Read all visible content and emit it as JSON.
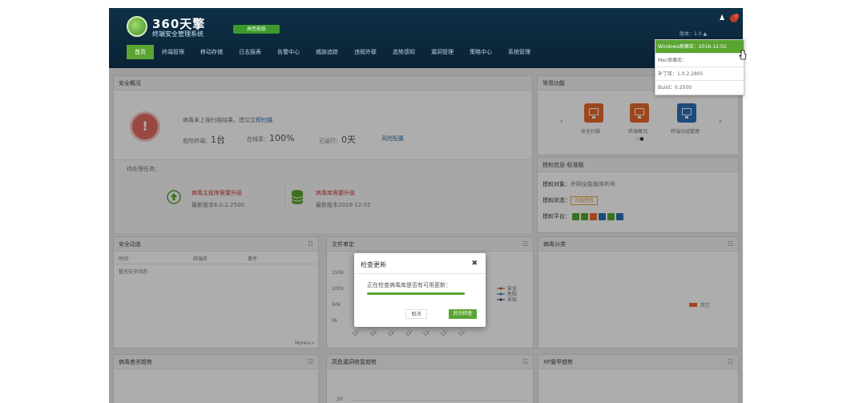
{
  "header": {
    "app_name": "360天擎",
    "app_subtitle": "终端安全管理系统",
    "edition": "高性能版",
    "version": "版本：1.0",
    "nav": [
      "首页",
      "终端管理",
      "移动存储",
      "日志报表",
      "告警中心",
      "威胁追踪",
      "违规外联",
      "态势感知",
      "漏洞管理",
      "策略中心",
      "系统管理"
    ]
  },
  "version_dropdown": {
    "items": [
      "Windows病毒库：2016-12-02",
      "Mac病毒库：",
      "补丁库：1.0.2.2805",
      "Build：0.2500"
    ]
  },
  "security_overview": {
    "title": "安全概况",
    "icon_text": "!",
    "message_prefix": "病毒未上报扫描结果，建议",
    "message_link": "立即扫描",
    "message_suffix": "",
    "risk_label": "危险终端：",
    "risk_value": "1台",
    "secure_label": "在线率：",
    "secure_value": "100%",
    "days_label": "已运行：",
    "days_value": "0天",
    "detail_link": "风险配置",
    "pending_title": "待处理任务：",
    "task1_title": "病毒主程序需要升级",
    "task1_sub": "最新版本6.0.2.2500",
    "task2_title": "病毒库需要升级",
    "task2_sub": "最新版本2016-12-02"
  },
  "common_functions": {
    "title": "常用功能",
    "items": [
      "安全扫描",
      "终端概况",
      "终端分组管理"
    ]
  },
  "license": {
    "title": "授权信息-标准版",
    "object_label": "授权对象：",
    "object_value": "外网全能版序列号",
    "status_label": "授权状态：",
    "status_value": "正版授权",
    "platform_label": "授权平台："
  },
  "security_dynamics": {
    "title": "安全动态",
    "columns": [
      "时间",
      "终端名",
      "事件"
    ],
    "empty": "暂无安全动态",
    "more": "More>>"
  },
  "file_audit": {
    "title": "文件审定",
    "legend": [
      "安全",
      "危险",
      "未知"
    ]
  },
  "virus_category": {
    "title": "病毒分类",
    "legend": "其它"
  },
  "bottom_panels": [
    "病毒查杀趋势",
    "高危漏洞修复趋势",
    "XP盾甲趋势"
  ],
  "chart_data": {
    "type": "line",
    "title": "文件审定",
    "y_ticks": [
      "150k",
      "100k",
      "50k",
      "0k"
    ],
    "x_ticks": [
      "12-",
      "12-",
      "12-",
      "12-",
      "12-",
      "12-",
      "12-"
    ],
    "series": [
      {
        "name": "安全",
        "color": "#d33a2c"
      },
      {
        "name": "危险",
        "color": "#2b6cb0"
      },
      {
        "name": "未知",
        "color": "#1f3b66"
      }
    ]
  },
  "chart2": {
    "y_ticks": [
      "20"
    ]
  },
  "dialog": {
    "title": "检查更新",
    "close": "✖",
    "message": "正在检查病毒库是否有可用更新：",
    "progress_fraction": 1.0,
    "cancel": "取消",
    "background": "后台检查"
  },
  "colors": {
    "accent": "#5aa532",
    "header": "#0f3147",
    "danger": "#d33a2c"
  }
}
